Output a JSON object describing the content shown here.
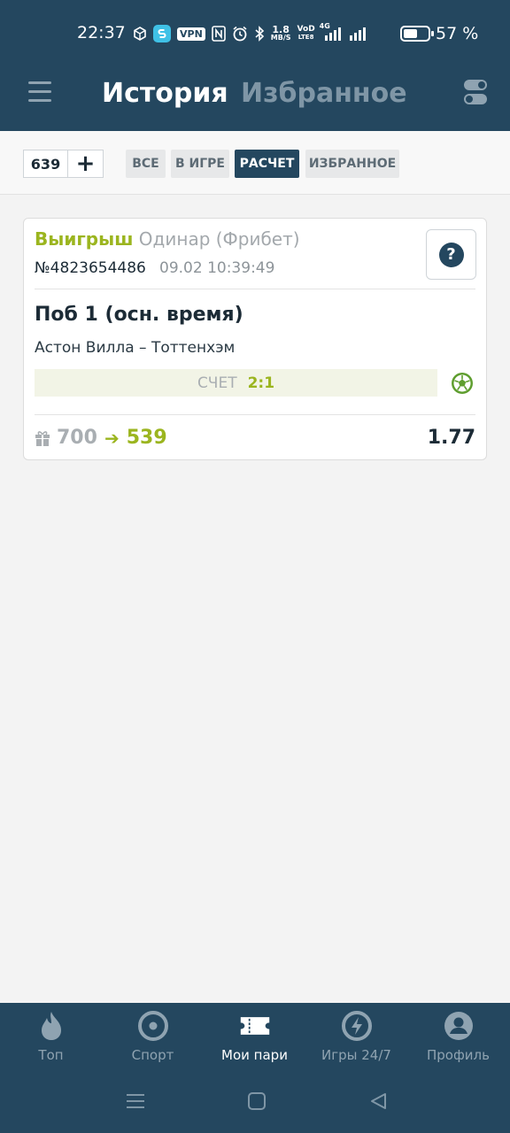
{
  "status_bar": {
    "time": "22:37",
    "vpn": "VPN",
    "net_speed_value": "1.8",
    "net_speed_unit": "MB/S",
    "volte_top": "VoD",
    "volte_bottom": "LTE8",
    "signal_tag": "4G",
    "battery_percent": "57 %",
    "battery_level": 0.57
  },
  "header": {
    "tab_history": "История",
    "tab_favorites": "Избранное"
  },
  "filters": {
    "count": "639",
    "add": "+",
    "items": [
      "ВСЕ",
      "В ИГРЕ",
      "РАСЧЕТ",
      "ИЗБРАННОЕ"
    ],
    "active_index": 2
  },
  "bet": {
    "result": "Выигрыш",
    "type": "Одинар (Фрибет)",
    "number": "№4823654486",
    "date": "09.02 10:39:49",
    "help": "?",
    "outcome": "Поб 1 (осн. время)",
    "match": "Астон Вилла – Тоттенхэм",
    "score_label": "СЧЕТ",
    "score": "2:1",
    "stake": "700",
    "arrow": "➔",
    "payout": "539",
    "coefficient": "1.77"
  },
  "bottom_nav": {
    "items": [
      {
        "label": "Топ",
        "icon": "fire-icon"
      },
      {
        "label": "Спорт",
        "icon": "target-icon"
      },
      {
        "label": "Мои пари",
        "icon": "ticket-icon"
      },
      {
        "label": "Игры 24/7",
        "icon": "lightning-icon"
      },
      {
        "label": "Профиль",
        "icon": "profile-icon"
      }
    ],
    "active_index": 2
  },
  "colors": {
    "brand": "#24475f",
    "win": "#9bb51f",
    "background": "#f3f3f3"
  }
}
